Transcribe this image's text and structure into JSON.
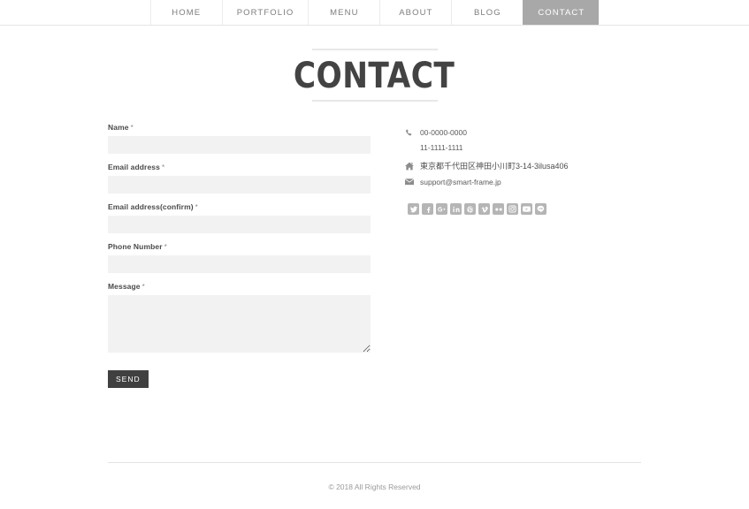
{
  "nav": {
    "items": [
      {
        "label": "HOME",
        "active": false
      },
      {
        "label": "PORTFOLIO",
        "active": false
      },
      {
        "label": "MENU",
        "active": false
      },
      {
        "label": "ABOUT",
        "active": false
      },
      {
        "label": "BLOG",
        "active": false
      },
      {
        "label": "CONTACT",
        "active": true
      }
    ]
  },
  "page": {
    "title": "CONTACT"
  },
  "form": {
    "required_mark": "*",
    "fields": [
      {
        "label": "Name",
        "value": "",
        "placeholder": "",
        "type": "text",
        "name": "name"
      },
      {
        "label": "Email address",
        "value": "",
        "placeholder": "",
        "type": "text",
        "name": "email"
      },
      {
        "label": "Email address(confirm)",
        "value": "",
        "placeholder": "",
        "type": "text",
        "name": "email-confirm"
      },
      {
        "label": "Phone Number",
        "value": "",
        "placeholder": "",
        "type": "text",
        "name": "phone"
      },
      {
        "label": "Message",
        "value": "",
        "placeholder": "",
        "type": "textarea",
        "name": "message"
      }
    ],
    "submit_label": "SEND"
  },
  "contact_info": {
    "phone_primary": "00-0000-0000",
    "phone_secondary": "11-1111-1111",
    "address": "東京都千代田区神田小川町3-14-3ilusa406",
    "email": "support@smart-frame.jp",
    "icons": {
      "phone": "phone-icon",
      "address": "home-icon",
      "email": "envelope-icon"
    }
  },
  "social": {
    "items": [
      {
        "name": "twitter",
        "label": "Twitter"
      },
      {
        "name": "facebook",
        "label": "Facebook"
      },
      {
        "name": "google-plus",
        "label": "Google Plus"
      },
      {
        "name": "linkedin",
        "label": "LinkedIn"
      },
      {
        "name": "pinterest",
        "label": "Pinterest"
      },
      {
        "name": "vimeo",
        "label": "Vimeo"
      },
      {
        "name": "flickr",
        "label": "Flickr"
      },
      {
        "name": "instagram",
        "label": "Instagram"
      },
      {
        "name": "youtube",
        "label": "YouTube"
      },
      {
        "name": "line",
        "label": "LINE"
      }
    ]
  },
  "footer": {
    "copyright": "© 2018 All Rights Reserved"
  },
  "colors": {
    "accent_active_tab": "#a8a8a8",
    "button_dark": "#404040",
    "input_bg": "#f2f2f2",
    "social_bg": "#b5b5b5",
    "text": "#555555"
  }
}
